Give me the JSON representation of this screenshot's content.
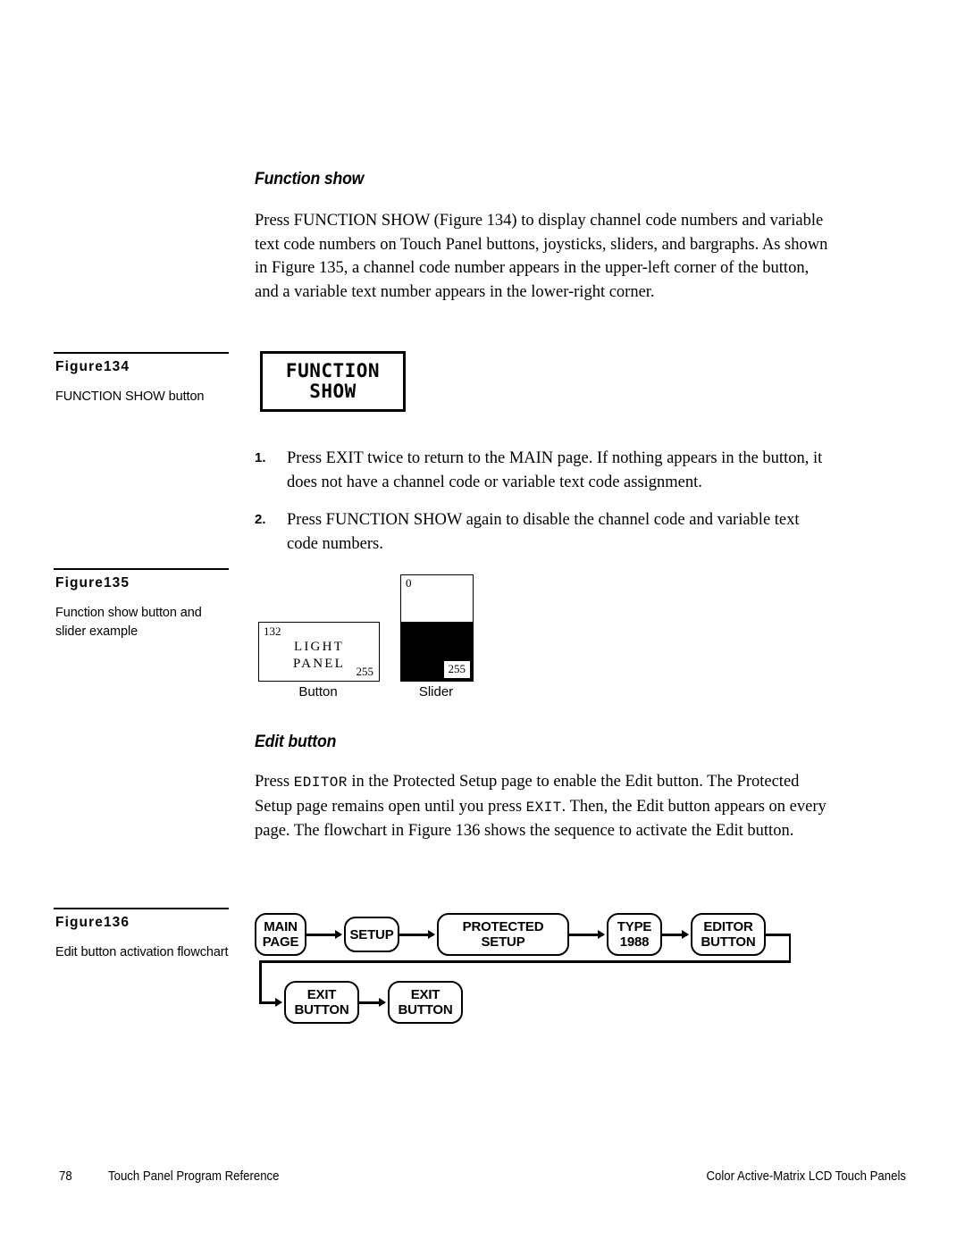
{
  "sections": {
    "function_show": {
      "heading": "Function show",
      "paragraph": "Press FUNCTION SHOW (Figure 134) to display channel code numbers and variable text code numbers on Touch Panel buttons, joysticks, sliders, and bargraphs. As shown in Figure 135, a channel code number appears in the upper-left corner of the button, and a variable text number appears in the lower-right corner.",
      "steps": [
        {
          "marker": "1.",
          "text": "Press EXIT twice to return to the MAIN page. If nothing appears in the button, it does not have a channel code or variable text code assignment."
        },
        {
          "marker": "2.",
          "text": "Press FUNCTION SHOW again to disable the channel code and variable text code numbers."
        }
      ]
    },
    "edit_button": {
      "heading": "Edit button",
      "paragraph_part1": "Press ",
      "paragraph_term1": "EDITOR",
      "paragraph_part2": " in the Protected Setup page to enable the Edit button. The Protected Setup page remains open until you press ",
      "paragraph_term2": "EXIT",
      "paragraph_part3": ". Then, the Edit button appears on every page. The flowchart in Figure 136 shows the sequence to activate the Edit button."
    }
  },
  "figures": {
    "fig134": {
      "label": "Figure134",
      "description": "FUNCTION SHOW button",
      "lcd_line1": "FUNCTION",
      "lcd_line2": "SHOW"
    },
    "fig135": {
      "label": "Figure135",
      "description": "Function show button and slider example",
      "button": {
        "channel_code": "132",
        "text_line1": "LIGHT",
        "text_line2": "PANEL",
        "variable_text": "255",
        "sublabel": "Button"
      },
      "slider": {
        "top_value": "0",
        "bottom_value": "255",
        "sublabel": "Slider",
        "fill_percent": 56
      }
    },
    "fig136": {
      "label": "Figure136",
      "description": "Edit button activation flowchart",
      "nodes": [
        {
          "line1": "MAIN",
          "line2": "PAGE"
        },
        {
          "line1": "SETUP",
          "line2": ""
        },
        {
          "line1": "PROTECTED",
          "line2": "SETUP"
        },
        {
          "line1": "TYPE",
          "line2": "1988"
        },
        {
          "line1": "EDITOR",
          "line2": "BUTTON"
        },
        {
          "line1": "EXIT",
          "line2": "BUTTON"
        },
        {
          "line1": "EXIT",
          "line2": "BUTTON"
        }
      ]
    }
  },
  "footer": {
    "page_number": "78",
    "left_text": "Touch Panel Program Reference",
    "right_text": "Color Active-Matrix LCD Touch Panels"
  }
}
